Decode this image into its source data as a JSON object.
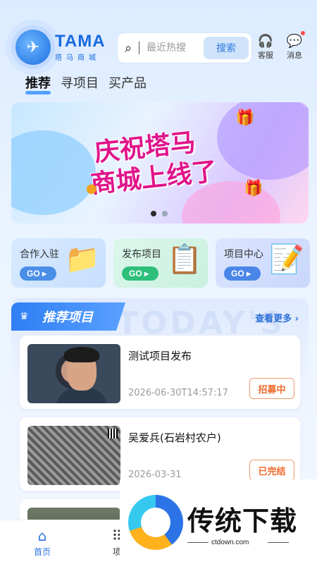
{
  "header": {
    "logo": {
      "brand": "TAMA",
      "subtitle": "塔马商城"
    },
    "search": {
      "placeholder": "最近热搜",
      "button_label": "搜索"
    },
    "service_label": "客服",
    "message_label": "消息"
  },
  "tabs": [
    {
      "label": "推荐",
      "active": true
    },
    {
      "label": "寻项目",
      "active": false
    },
    {
      "label": "买产品",
      "active": false
    }
  ],
  "banner": {
    "line1": "庆祝塔马",
    "line2": "商城上线了",
    "slide_count": 2,
    "active_slide": 1
  },
  "shortcuts": [
    {
      "label": "合作入驻",
      "button": "GO ▸",
      "icon": "folder-icon"
    },
    {
      "label": "发布项目",
      "button": "GO ▸",
      "icon": "document-icon"
    },
    {
      "label": "项目中心",
      "button": "GO ▸",
      "icon": "checklist-icon"
    }
  ],
  "recommend": {
    "title": "推荐项目",
    "more_label": "查看更多 ›",
    "watermark": "TODAY'S",
    "items": [
      {
        "title": "测试项目发布",
        "date": "2026-06-30T14:57:17",
        "status": "招募中"
      },
      {
        "title": "吴爱兵(石岩村农户)",
        "date": "2026-03-31",
        "status": "已完结"
      },
      {
        "title": "",
        "date": "",
        "status": ""
      }
    ]
  },
  "bottom_nav": {
    "home_label": "首页",
    "project_label": "项"
  },
  "overlay": {
    "title": "传统下载",
    "url": "ctdown.com"
  },
  "colors": {
    "accent": "#2f7ef4",
    "status_orange": "#ee6a2c",
    "banner_text": "#e0148a"
  }
}
